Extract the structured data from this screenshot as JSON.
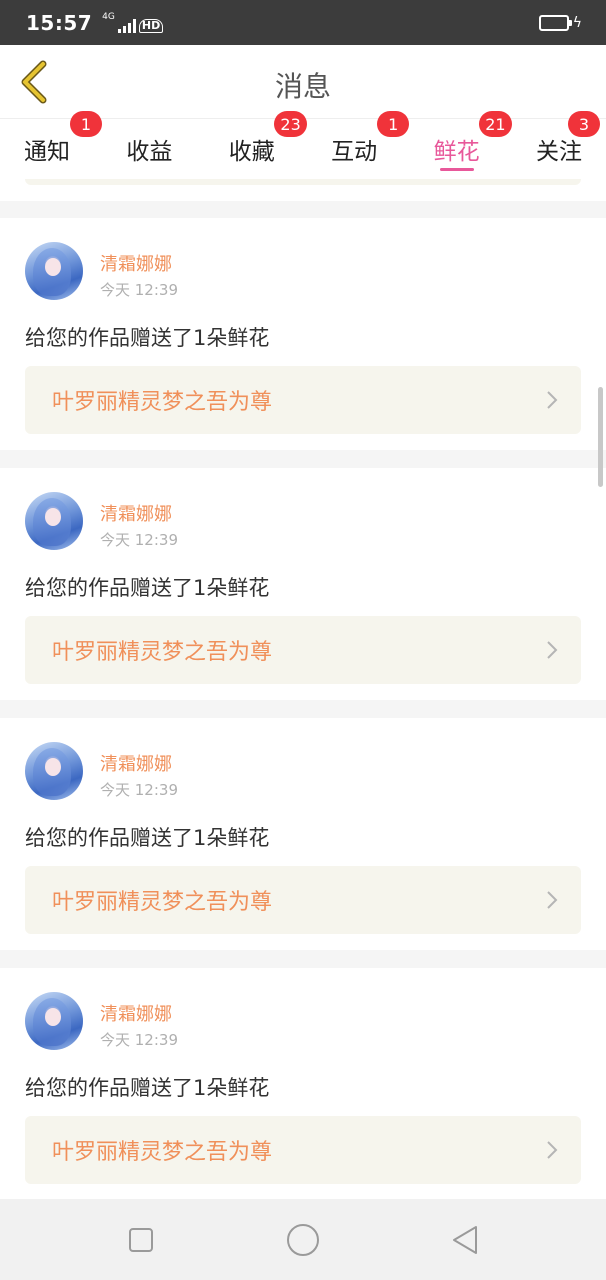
{
  "status_bar": {
    "time": "15:57",
    "network": "4G",
    "hd": "HD"
  },
  "header": {
    "title": "消息"
  },
  "tabs": [
    {
      "label": "通知",
      "badge": "1",
      "active": false
    },
    {
      "label": "收益",
      "badge": "",
      "active": false
    },
    {
      "label": "收藏",
      "badge": "23",
      "active": false
    },
    {
      "label": "互动",
      "badge": "1",
      "active": false
    },
    {
      "label": "鲜花",
      "badge": "21",
      "active": true
    },
    {
      "label": "关注",
      "badge": "3",
      "active": false
    }
  ],
  "messages": [
    {
      "username": "清霜娜娜",
      "time": "今天 12:39",
      "text": "给您的作品赠送了1朵鲜花",
      "work_title": "叶罗丽精灵梦之吾为尊"
    },
    {
      "username": "清霜娜娜",
      "time": "今天 12:39",
      "text": "给您的作品赠送了1朵鲜花",
      "work_title": "叶罗丽精灵梦之吾为尊"
    },
    {
      "username": "清霜娜娜",
      "time": "今天 12:39",
      "text": "给您的作品赠送了1朵鲜花",
      "work_title": "叶罗丽精灵梦之吾为尊"
    },
    {
      "username": "清霜娜娜",
      "time": "今天 12:39",
      "text": "给您的作品赠送了1朵鲜花",
      "work_title": "叶罗丽精灵梦之吾为尊"
    }
  ],
  "colors": {
    "accent": "#e8589a",
    "badge": "#f0333a",
    "username": "#f0905a",
    "work_link_bg": "#f6f5ed",
    "back_arrow": "#e6c431"
  },
  "icons": {
    "back": "chevron-left-icon",
    "chevron": "chevron-right-icon",
    "nav_recent": "square-icon",
    "nav_home": "circle-icon",
    "nav_back": "triangle-back-icon"
  }
}
